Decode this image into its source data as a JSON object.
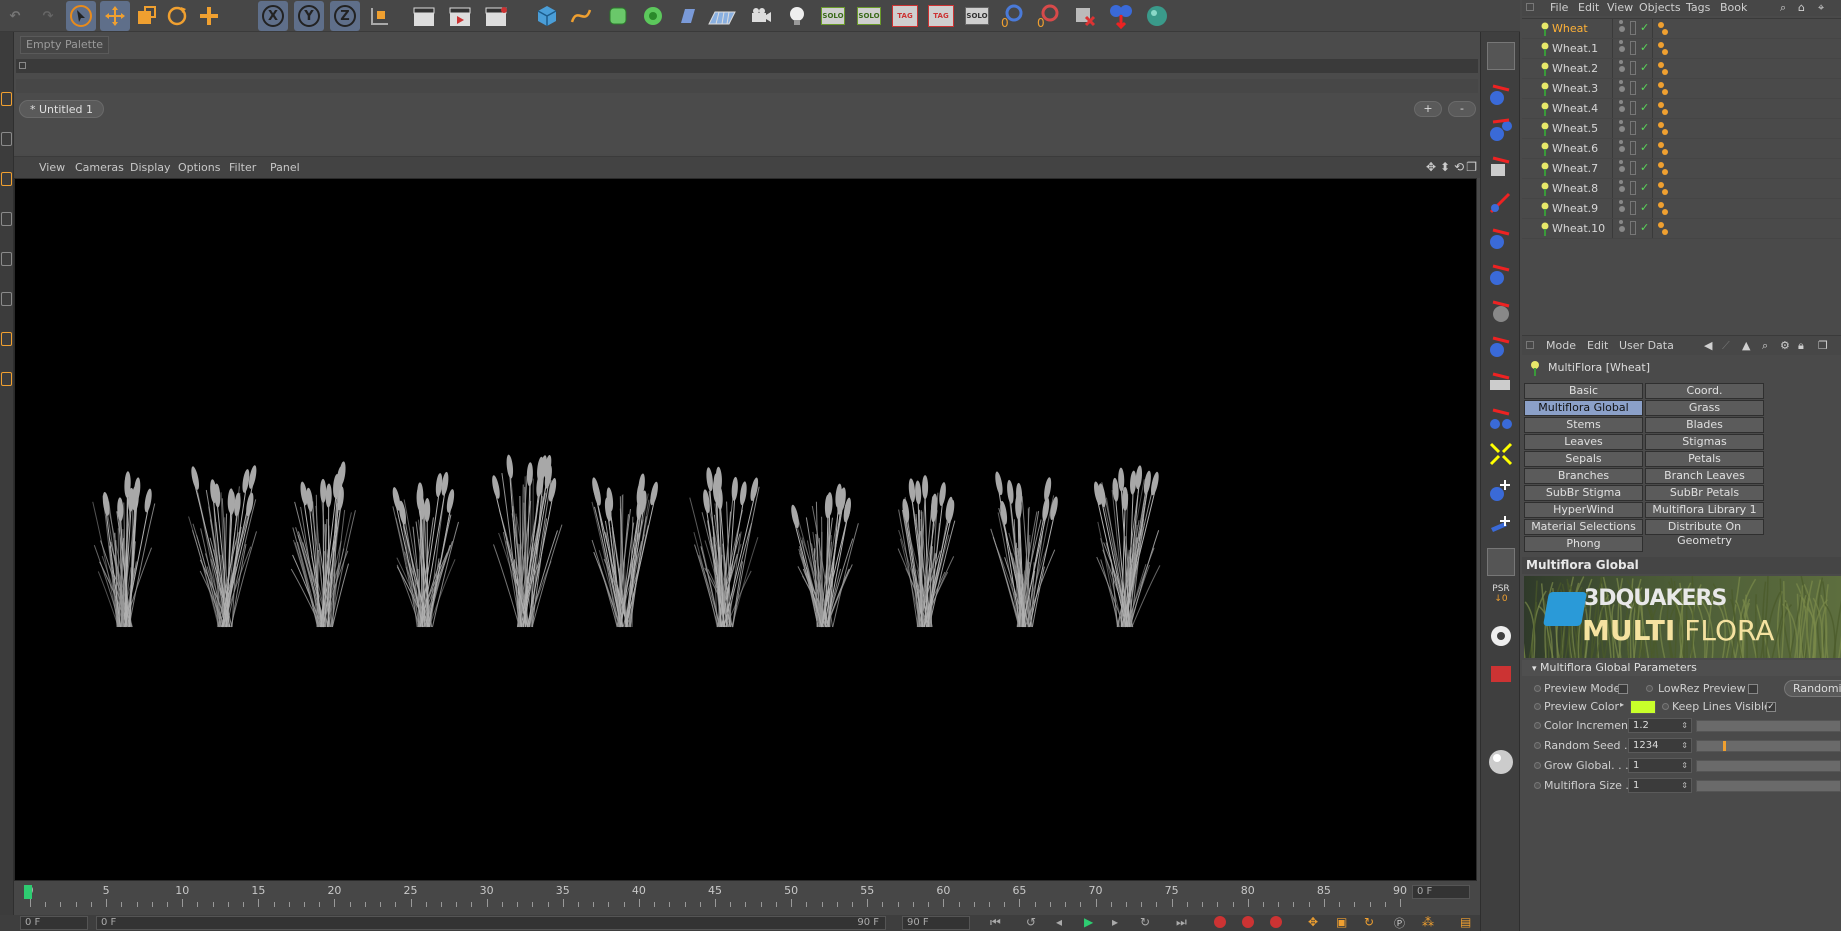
{
  "window": {
    "palette_label": "Empty Palette",
    "tab_label": "* Untitled 1",
    "tab_add": "+",
    "tab_remove": "-"
  },
  "toolbar": {
    "axis_x": "X",
    "axis_y": "Y",
    "axis_z": "Z",
    "solo_labels": [
      "SOLO",
      "SOLO",
      "SOLO",
      "SOLO",
      "SOLO"
    ],
    "tag_label": "TAG"
  },
  "viewport": {
    "menu": [
      "View",
      "Cameras",
      "Display",
      "Options",
      "Filter",
      "Panel"
    ],
    "plant_count": 11,
    "background": "#000000"
  },
  "timeline": {
    "ticks": [
      "0",
      "5",
      "10",
      "15",
      "20",
      "25",
      "30",
      "35",
      "40",
      "45",
      "50",
      "55",
      "60",
      "65",
      "70",
      "75",
      "80",
      "85",
      "90"
    ],
    "current_frame": "0 F",
    "end_frame_display": "0 F",
    "start_field": "0 F",
    "range_start": "0 F",
    "range_end": "90 F",
    "max_field": "90 F"
  },
  "object_manager": {
    "menu": [
      "File",
      "Edit",
      "View",
      "Objects",
      "Tags",
      "Book"
    ],
    "objects": [
      "Wheat",
      "Wheat.1",
      "Wheat.2",
      "Wheat.3",
      "Wheat.4",
      "Wheat.5",
      "Wheat.6",
      "Wheat.7",
      "Wheat.8",
      "Wheat.9",
      "Wheat.10"
    ],
    "active_index": 0,
    "active_color": "#ffb238"
  },
  "attribute_manager": {
    "menu": [
      "Mode",
      "Edit",
      "User Data"
    ],
    "object_title": "MultiFlora [Wheat]",
    "tabs_left": [
      "Basic",
      "Multiflora Global",
      "Stems",
      "Leaves",
      "Sepals",
      "Branches",
      "SubBr Stigma",
      "HyperWind",
      "Material Selections",
      "Phong"
    ],
    "tabs_right": [
      "Coord.",
      "Grass",
      "Blades",
      "Stigmas",
      "Petals",
      "Branch Leaves",
      "SubBr Petals",
      "Multiflora Library 1",
      "Distribute On Geometry"
    ],
    "selected_tab": "Multiflora Global",
    "section_title": "Multiflora Global",
    "banner_line1": "3DQUAKERS",
    "banner_line2a": "MULTI",
    "banner_line2b": "FLORA",
    "params_header": "Multiflora Global Parameters",
    "preview_mode": "Preview Mode",
    "lowrez_preview": "LowRez Preview",
    "randomize": "Randomize",
    "preview_color": "Preview Color",
    "preview_color_value": "#c8ff2a",
    "keep_lines_visible": "Keep Lines Visible",
    "params": [
      {
        "label": "Color Increment",
        "value": "1.2",
        "slider": 0.0
      },
      {
        "label": "Random Seed . .",
        "value": "1234",
        "slider": 0.18
      },
      {
        "label": "Grow Global. . . .",
        "value": "1",
        "slider": 1.0
      },
      {
        "label": "Multiflora Size . .",
        "value": "1",
        "slider": 1.0
      }
    ]
  }
}
